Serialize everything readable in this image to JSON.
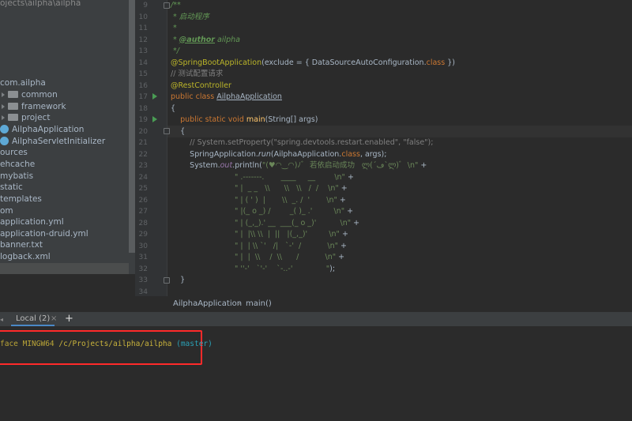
{
  "project_tree": {
    "path": "ojects\\ailpha\\ailpha",
    "items": [
      {
        "label": "com.ailpha",
        "icon": "folder-icon"
      },
      {
        "label": "common",
        "icon": "folder-icon"
      },
      {
        "label": "framework",
        "icon": "folder-icon"
      },
      {
        "label": "project",
        "icon": "folder-icon"
      },
      {
        "label": "AilphaApplication",
        "icon": "spring-class-icon"
      },
      {
        "label": "AilphaServletInitializer",
        "icon": "spring-class-icon"
      },
      {
        "label": "ources",
        "icon": "folder-icon"
      },
      {
        "label": "ehcache",
        "icon": "folder-icon"
      },
      {
        "label": "mybatis",
        "icon": "folder-icon"
      },
      {
        "label": "static",
        "icon": "folder-icon"
      },
      {
        "label": "templates",
        "icon": "folder-icon"
      },
      {
        "label": "om",
        "icon": "file-icon"
      },
      {
        "label": "application.yml",
        "icon": "yml-file-icon"
      },
      {
        "label": "application-druid.yml",
        "icon": "yml-file-icon"
      },
      {
        "label": "banner.txt",
        "icon": "text-file-icon"
      },
      {
        "label": "logback.xml",
        "icon": "xml-file-icon"
      }
    ]
  },
  "editor": {
    "line_numbers": [
      "9",
      "10",
      "11",
      "12",
      "13",
      "14",
      "15",
      "16",
      "17",
      "18",
      "19",
      "20",
      "21",
      "22",
      "23",
      "24",
      "25",
      "26",
      "27",
      "28",
      "29",
      "30",
      "31",
      "32",
      "33",
      "34"
    ],
    "lines": {
      "l9": "/**",
      "l10": " * 启动程序",
      "l11": " *",
      "l12_prefix": " * ",
      "l12_tag": "@author",
      "l12_name": " ailpha",
      "l13": " */",
      "l14_ann": "@SpringBootApplication",
      "l14_rest": "(exclude = { DataSourceAutoConfiguration.",
      "l14_kw": "class",
      "l14_end": " })",
      "l15": "// 测试配置请求",
      "l16": "@RestController",
      "l17_kw": "public class ",
      "l17_cls": "AilphaApplication",
      "l18": "{",
      "l19_kw": "    public static void ",
      "l19_fn": "main",
      "l19_rest": "(String[] args)",
      "l20": "    {",
      "l21": "        // System.setProperty(\"spring.devtools.restart.enabled\", \"false\");",
      "l22_a": "        SpringApplication.",
      "l22_b": "run",
      "l22_c": "(AilphaApplication.",
      "l22_d": "class",
      "l22_e": ", args);",
      "l23_a": "        System.",
      "l23_b": "out",
      "l23_c": ".println(",
      "l23_d": "\"(♥◠‿◠)ﾉﾞ  若依启动成功   ლ(´ڡ`ლ)ﾞ  \\n\"",
      "l23_e": " +",
      "l24": "\" .-------.       ____     __        \\n\"",
      "l25": "\" |  _ _   \\\\      \\\\   \\\\   /  /    \\n\"",
      "l26": "\" | ( ' )  |       \\\\  _. /  '       \\n\"",
      "l27": "\" |(_ o _) /        _( )_ .'         \\n\"",
      "l28": "\" | (_,_).' __  ___(_ o _)'          \\n\"",
      "l29": "\" |  |\\\\ \\\\  |  ||   |(_,_)'         \\n\"",
      "l30": "\" |  | \\\\ `'   /|   `-'  /           \\n\"",
      "l31": "\" |  |  \\\\    /  \\\\      /           \\n\"",
      "l32": "\" ''-'   `'-'    `-..-'              \"",
      "l33": "    }",
      "plus": " +",
      "close": ");"
    }
  },
  "breadcrumb": {
    "class_name": "AilphaApplication",
    "separator": "›",
    "method": "main()"
  },
  "terminal": {
    "tab_label": "Local (2)",
    "tab_close": "×",
    "add_tab": "+",
    "prompt_host": "face MINGW64",
    "prompt_path": "/c/Projects/ailpha/ailpha",
    "prompt_branch": "(master)"
  },
  "colors": {
    "keyword": "#cc7832",
    "annotation": "#bbb529",
    "string": "#6a8759",
    "comment": "#629755",
    "highlight_box": "#ff2a2a"
  }
}
